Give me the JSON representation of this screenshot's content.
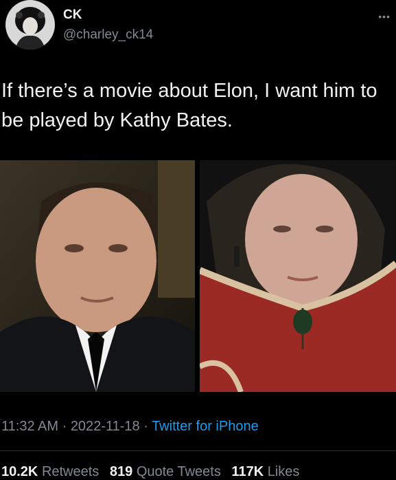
{
  "user": {
    "display_name": "CK",
    "handle": "@charley_ck14"
  },
  "more_label": "•••",
  "tweet": {
    "text": "If there’s a movie about Elon, I want him to be played by Kathy Bates."
  },
  "meta": {
    "time": "11:32 AM",
    "separator1": " · ",
    "date": "2022-11-18",
    "separator2": " · ",
    "source": "Twitter for iPhone"
  },
  "stats": {
    "retweets_count": "10.2K",
    "retweets_label": "Retweets",
    "quotes_count": "819",
    "quotes_label": "Quote Tweets",
    "likes_count": "117K",
    "likes_label": "Likes"
  },
  "colors": {
    "background": "#000000",
    "link": "#1d9bf0",
    "secondary_text": "#7f8a94"
  }
}
